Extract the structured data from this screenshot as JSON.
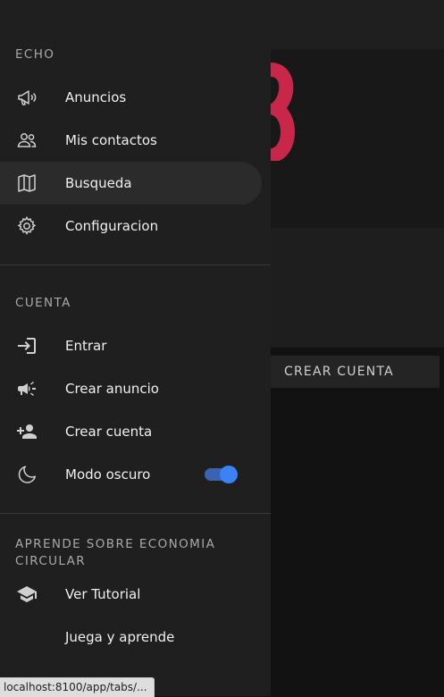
{
  "background": {
    "create_account_button": "CREAR CUENTA",
    "logo_color": "#c8274a"
  },
  "menu": {
    "section1": {
      "title": "ECHO",
      "items": [
        {
          "label": "Anuncios",
          "icon": "megaphone-outline-icon"
        },
        {
          "label": "Mis contactos",
          "icon": "people-outline-icon"
        },
        {
          "label": "Busqueda",
          "icon": "map-outline-icon",
          "active": true
        },
        {
          "label": "Configuracion",
          "icon": "gear-outline-icon"
        }
      ]
    },
    "section2": {
      "title": "CUENTA",
      "items": [
        {
          "label": "Entrar",
          "icon": "login-icon"
        },
        {
          "label": "Crear anuncio",
          "icon": "megaphone-filled-icon"
        },
        {
          "label": "Crear cuenta",
          "icon": "person-add-icon"
        },
        {
          "label": "Modo oscuro",
          "icon": "moon-icon",
          "toggle_on": true
        }
      ]
    },
    "section3": {
      "title": "APRENDE SOBRE ECONOMIA CIRCULAR",
      "items": [
        {
          "label": "Ver Tutorial",
          "icon": "school-icon"
        },
        {
          "label": "Juega y aprende"
        }
      ]
    }
  },
  "statusbar": {
    "url": "localhost:8100/app/tabs/..."
  },
  "colors": {
    "accent": "#3a82f6",
    "drawer_bg": "#1f1f1f",
    "active_item_bg": "#2b2b2b"
  }
}
